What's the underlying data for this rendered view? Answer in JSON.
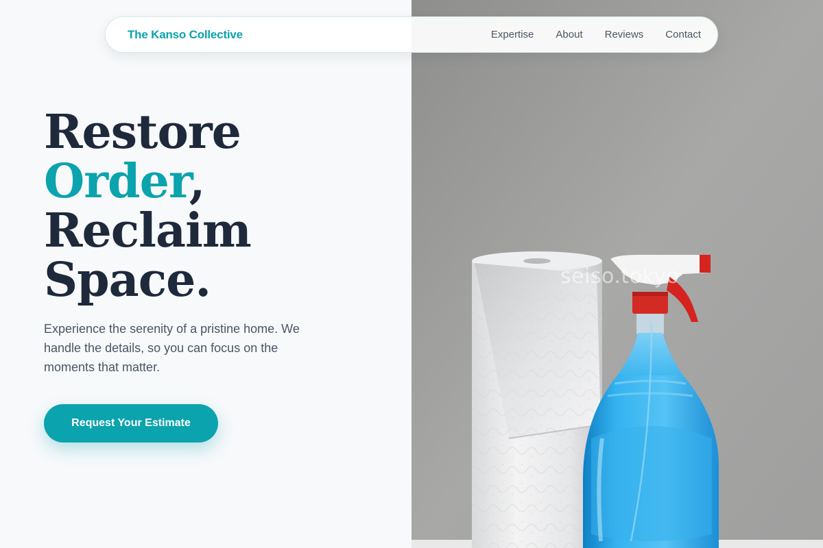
{
  "nav": {
    "brand": "The Kanso Collective",
    "links": [
      "Expertise",
      "About",
      "Reviews",
      "Contact"
    ]
  },
  "hero": {
    "headline": {
      "line1": "Restore",
      "line2_accent": "Order",
      "line2_rest": ",",
      "line3": "Reclaim",
      "line4": "Space."
    },
    "subtext": "Experience the serenity of a pristine home. We handle the details, so you can focus on the moments that matter.",
    "cta_label": "Request Your Estimate",
    "image_watermark": "seiso.tokyo"
  },
  "colors": {
    "accent": "#0ba3ad",
    "heading": "#1e293b",
    "body_text": "#4b5563",
    "page_bg": "#f7f9fb"
  }
}
